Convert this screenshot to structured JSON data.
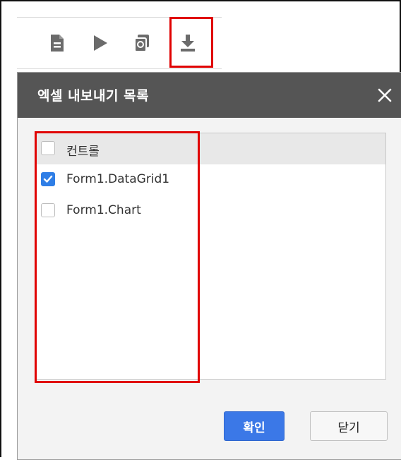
{
  "toolbar": {
    "buttons": [
      {
        "icon": "document-icon"
      },
      {
        "icon": "play-icon"
      },
      {
        "icon": "copy-icon"
      },
      {
        "icon": "download-icon"
      }
    ]
  },
  "dialog": {
    "title": "엑셀 내보내기 목록",
    "close_icon": "close-icon",
    "list": {
      "header": {
        "label": "컨트롤",
        "checked": false
      },
      "items": [
        {
          "label": "Form1.DataGrid1",
          "checked": true
        },
        {
          "label": "Form1.Chart",
          "checked": false
        }
      ]
    },
    "buttons": {
      "ok_label": "확인",
      "close_label": "닫기"
    }
  },
  "colors": {
    "header_bg": "#555555",
    "primary_button": "#3b78e7",
    "checkbox_checked": "#2f7ee6",
    "highlight_border": "#e00000"
  }
}
